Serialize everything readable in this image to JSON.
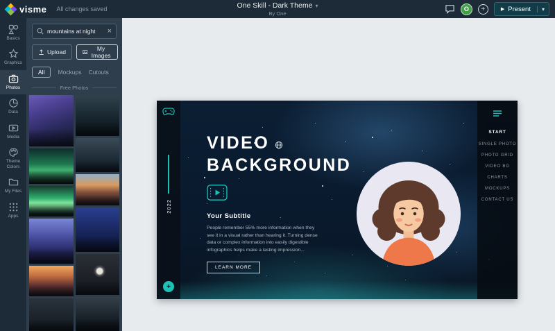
{
  "colors": {
    "accent": "#19c3b8",
    "topbar_bg": "#1d2b38",
    "panel_bg": "#2f3e4d",
    "canvas_bg": "#e8ebee",
    "slide_bg": "#0b1e33",
    "avatar_green": "#43a047"
  },
  "icons": {
    "chevron_down": "▾",
    "play": "▶",
    "plus": "+",
    "close": "×"
  },
  "topbar": {
    "logo_text": "visme",
    "status": "All changes saved",
    "doc_title": "One Skill - Dark Theme",
    "doc_subtitle": "By One",
    "avatar_initial": "O",
    "present_label": "Present"
  },
  "rail": {
    "items": [
      {
        "label": "Basics"
      },
      {
        "label": "Graphics"
      },
      {
        "label": "Photos"
      },
      {
        "label": "Data"
      },
      {
        "label": "Media"
      },
      {
        "label": "Theme Colors"
      },
      {
        "label": "My Files"
      },
      {
        "label": "Apps"
      }
    ]
  },
  "panel": {
    "search_value": "mountains at night",
    "upload_label": "Upload",
    "my_images_label": "My Images",
    "tabs": [
      "All",
      "Mockups",
      "Cutouts"
    ],
    "section_label": "Free Photos"
  },
  "slide": {
    "year": "2022",
    "title_line1": "VIDEO",
    "title_line2": "BACKGROUND",
    "subtitle": "Your Subtitle",
    "body": "People remember 55% more information when they see it in a visual rather than hearing it. Turning dense data or complex information into easily digestible infographics helps make a lasting impression...",
    "cta": "LEARN MORE",
    "menu": [
      "START",
      "SINGLE PHOTO",
      "PHOTO GRID",
      "VIDEO BG",
      "CHARTS",
      "MOCKUPS",
      "CONTACT US"
    ]
  }
}
